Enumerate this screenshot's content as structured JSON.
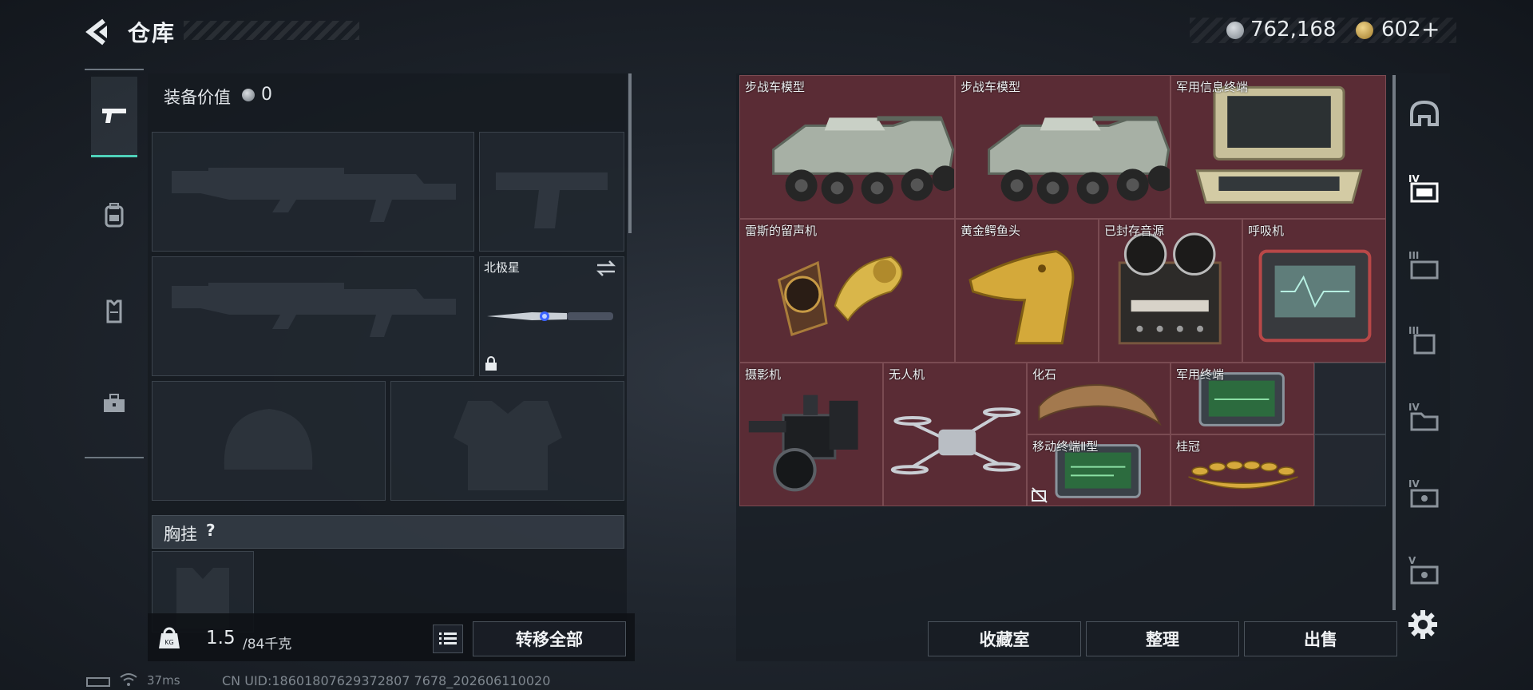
{
  "header": {
    "title": "仓库",
    "currency_primary": "762,168",
    "currency_secondary": "602",
    "currency_plus": "+"
  },
  "equipment": {
    "value_label": "装备价值",
    "value": "0",
    "melee_name": "北极星",
    "chest_label": "胸挂",
    "chest_help": "?",
    "weight_current": "1.5",
    "weight_max": "/84千克",
    "transfer_all_label": "转移全部"
  },
  "storage": {
    "items": [
      {
        "name": "步战车模型",
        "icon": "ifv-model",
        "row": 0,
        "col": 0,
        "w": 3,
        "h": 2
      },
      {
        "name": "步战车模型",
        "icon": "ifv-model",
        "row": 0,
        "col": 3,
        "w": 3,
        "h": 2
      },
      {
        "name": "军用信息终端",
        "icon": "military-info-terminal",
        "row": 0,
        "col": 6,
        "w": 3,
        "h": 2
      },
      {
        "name": "雷斯的留声机",
        "icon": "gramophone",
        "row": 2,
        "col": 0,
        "w": 3,
        "h": 2
      },
      {
        "name": "黄金鳄鱼头",
        "icon": "golden-crocodile-head",
        "row": 2,
        "col": 3,
        "w": 2,
        "h": 2
      },
      {
        "name": "已封存音源",
        "icon": "reel-recorder",
        "row": 2,
        "col": 5,
        "w": 2,
        "h": 2
      },
      {
        "name": "呼吸机",
        "icon": "ventilator",
        "row": 2,
        "col": 7,
        "w": 2,
        "h": 2
      },
      {
        "name": "摄影机",
        "icon": "video-camera",
        "row": 4,
        "col": 0,
        "w": 2,
        "h": 2
      },
      {
        "name": "无人机",
        "icon": "drone",
        "row": 4,
        "col": 2,
        "w": 2,
        "h": 2
      },
      {
        "name": "化石",
        "icon": "fossil-claw",
        "row": 4,
        "col": 4,
        "w": 2,
        "h": 1
      },
      {
        "name": "军用终端",
        "icon": "military-terminal",
        "row": 4,
        "col": 6,
        "w": 2,
        "h": 1
      },
      {
        "name": "移动终端Ⅱ型",
        "icon": "mobile-terminal-2",
        "row": 5,
        "col": 4,
        "w": 2,
        "h": 1
      },
      {
        "name": "桂冠",
        "icon": "laurel-crown",
        "row": 5,
        "col": 6,
        "w": 2,
        "h": 1
      }
    ],
    "collection_label": "收藏室",
    "sort_label": "整理",
    "sell_label": "出售"
  },
  "status": {
    "ping": "37ms",
    "uid": "CN UID:18601807629372807 7678_202606110020"
  },
  "colors": {
    "item_bg": "#5a2c35",
    "accent": "#4fd1b9",
    "panel": "#1a1f26"
  }
}
